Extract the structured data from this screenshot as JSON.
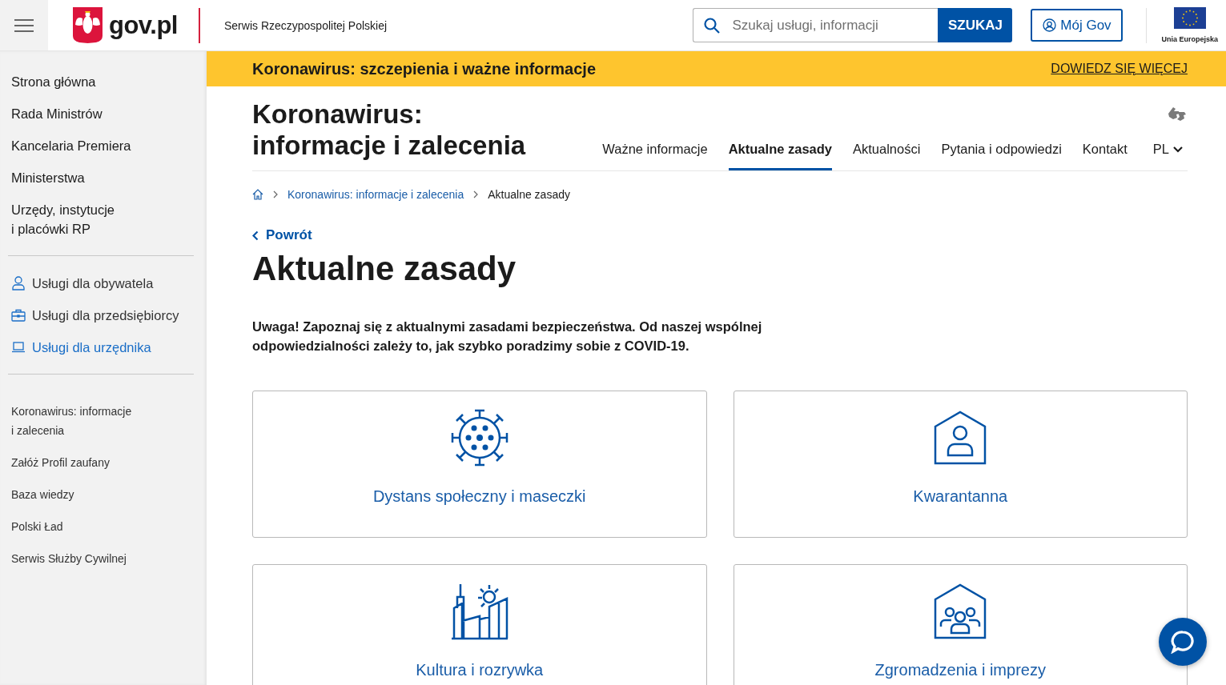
{
  "header": {
    "site_name": "gov.pl",
    "tagline": "Serwis Rzeczypospolitej Polskiej",
    "search": {
      "placeholder": "Szukaj usługi, informacji"
    },
    "search_button": "SZUKAJ",
    "account_button": "Mój Gov",
    "eu_label": "Unia Europejska"
  },
  "sidebar": {
    "primary": [
      "Strona główna",
      "Rada Ministrów",
      "Kancelaria Premiera",
      "Ministerstwa",
      "Urzędy, instytucje\ni placówki RP"
    ],
    "services": [
      {
        "label": "Usługi dla obywatela",
        "kind": "person",
        "selected": false
      },
      {
        "label": "Usługi dla przedsiębiorcy",
        "kind": "briefcase",
        "selected": false
      },
      {
        "label": "Usługi dla urzędnika",
        "kind": "laptop",
        "selected": true
      }
    ],
    "links": [
      "Koronawirus: informacje\ni zalecenia",
      "Załóż Profil zaufany",
      "Baza wiedzy",
      "Polski Ład",
      "Serwis Służby Cywilnej"
    ]
  },
  "banner": {
    "text": "Koronawirus: szczepienia i ważne informacje",
    "link": "DOWIEDZ SIĘ WIĘCEJ"
  },
  "section": {
    "title": "Koronawirus:\ninformacje i zalecenia",
    "tabs": [
      {
        "label": "Ważne informacje",
        "selected": false
      },
      {
        "label": "Aktualne zasady",
        "selected": true
      },
      {
        "label": "Aktualności",
        "selected": false
      },
      {
        "label": "Pytania i odpowiedzi",
        "selected": false
      },
      {
        "label": "Kontakt",
        "selected": false
      }
    ],
    "language": "PL"
  },
  "breadcrumb": [
    "Koronawirus: informacje i zalecenia",
    "Aktualne zasady"
  ],
  "back_link": "Powrót",
  "page_title": "Aktualne zasady",
  "intro": "Uwaga! Zapoznaj się z aktualnymi zasadami bezpieczeństwa. Od naszej wspólnej odpowiedzialności zależy to, jak szybko poradzimy sobie z COVID-19.",
  "cards": [
    {
      "title": "Dystans społeczny i maseczki",
      "kind": "virus"
    },
    {
      "title": "Kwarantanna",
      "kind": "house-person"
    },
    {
      "title": "Kultura i rozrywka",
      "kind": "city"
    },
    {
      "title": "Zgromadzenia i imprezy",
      "kind": "house-group"
    }
  ]
}
